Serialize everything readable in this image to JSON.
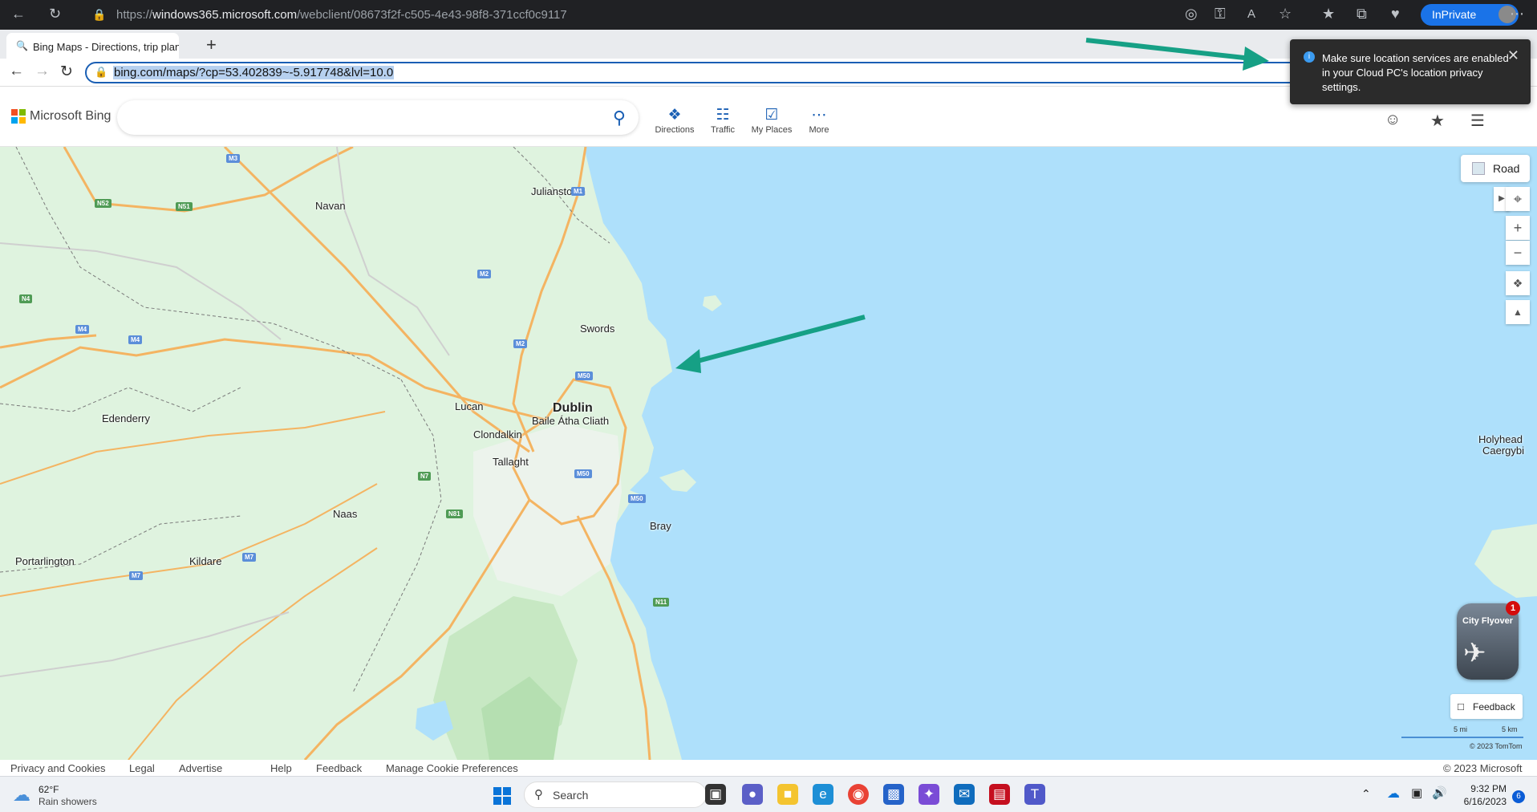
{
  "host": {
    "url_prefix": "https://",
    "url_domain": "windows365.microsoft.com",
    "url_path": "/webclient/08673f2f-c505-4e43-98f8-371ccf0c9117",
    "inprivate_label": "InPrivate"
  },
  "browser": {
    "tab_title": "Bing Maps - Directions, trip plan",
    "address": "bing.com/maps/?cp=53.402839~-5.917748&lvl=10.0"
  },
  "header": {
    "brand": "Microsoft Bing",
    "search_placeholder": "",
    "buttons": [
      {
        "label": "Directions",
        "icon": "directions-icon"
      },
      {
        "label": "Traffic",
        "icon": "traffic-icon"
      },
      {
        "label": "My Places",
        "icon": "my-places-icon"
      },
      {
        "label": "More",
        "icon": "more-icon"
      }
    ]
  },
  "toast": {
    "message": "Make sure location services are enabled in your Cloud PC's location privacy settings."
  },
  "map": {
    "road_label": "Road",
    "places": {
      "julianstown": "Julianstown",
      "navan": "Navan",
      "swords": "Swords",
      "lucan": "Lucan",
      "dublin": "Dublin",
      "baile_atha_cliath": "Baile Átha Cliath",
      "edenderry": "Edenderry",
      "clondalkin": "Clondalkin",
      "tallaght": "Tallaght",
      "naas": "Naas",
      "bray": "Bray",
      "portarlington": "Portarlington",
      "kildare": "Kildare",
      "holyhead": "Holyhead",
      "caergybi": "Caergybi"
    },
    "shields": {
      "m3": "M3",
      "m1": "M1",
      "n52": "N52",
      "n51": "N51",
      "m2a": "M2",
      "n4": "N4",
      "m4a": "M4",
      "m4b": "M4",
      "m2b": "M2",
      "m50a": "M50",
      "m50b": "M50",
      "m50c": "M50",
      "n7": "N7",
      "n81": "N81",
      "m7a": "M7",
      "m7b": "M7",
      "n11": "N11"
    },
    "flyover_label": "City Flyover",
    "flyover_badge": "1",
    "feedback_label": "Feedback",
    "scale_mi": "5 mi",
    "scale_km": "5 km",
    "tomtom": "© 2023 TomTom"
  },
  "footer": {
    "links": [
      "Privacy and Cookies",
      "Legal",
      "Advertise",
      "Help",
      "Feedback",
      "Manage Cookie Preferences"
    ],
    "copyright": "© 2023 Microsoft"
  },
  "taskbar": {
    "weather_temp": "62°F",
    "weather_desc": "Rain showers",
    "search_label": "Search",
    "time": "9:32 PM",
    "date": "6/16/2023",
    "notification_count": "6"
  },
  "colors": {
    "water": "#aee0fb",
    "land": "#dff3df",
    "accent": "#1a5fb4"
  }
}
